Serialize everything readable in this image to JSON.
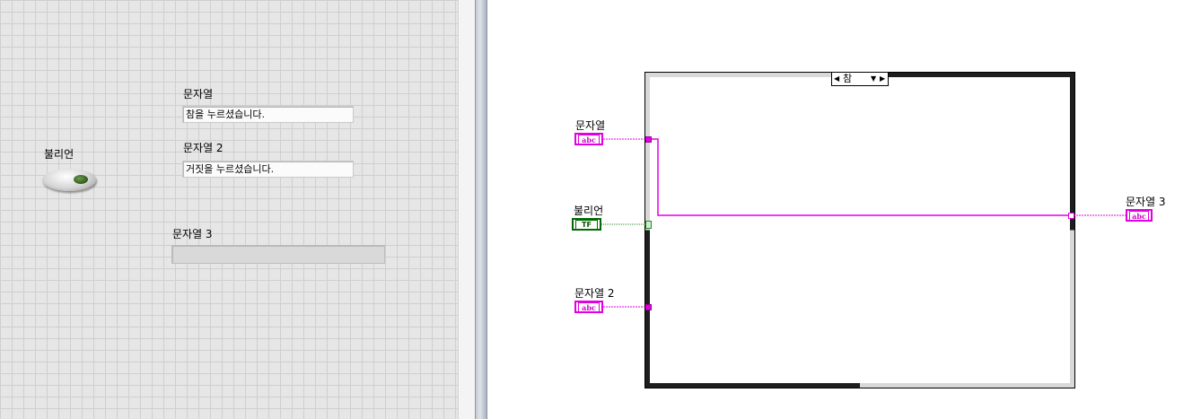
{
  "front_panel": {
    "string1": {
      "label": "문자열",
      "value": "참을 누르셨습니다."
    },
    "string2": {
      "label": "문자열 2",
      "value": "거짓을 누르셨습니다."
    },
    "string3": {
      "label": "문자열 3",
      "value": ""
    },
    "boolean": {
      "label": "불리언"
    }
  },
  "block_diagram": {
    "case_structure": {
      "selector_value": "참",
      "left_arrow": "◀",
      "dropdown": "▼",
      "right_arrow": "▶"
    },
    "terminals": {
      "string1": {
        "label": "문자열",
        "type_text": "abc"
      },
      "boolean": {
        "label": "불리언",
        "type_text": "TF"
      },
      "string2": {
        "label": "문자열 2",
        "type_text": "abc"
      },
      "string3": {
        "label": "문자열 3",
        "type_text": "abc"
      }
    },
    "colors": {
      "string_wire": "#e100e1",
      "boolean_wire": "#2e8b2e"
    }
  }
}
